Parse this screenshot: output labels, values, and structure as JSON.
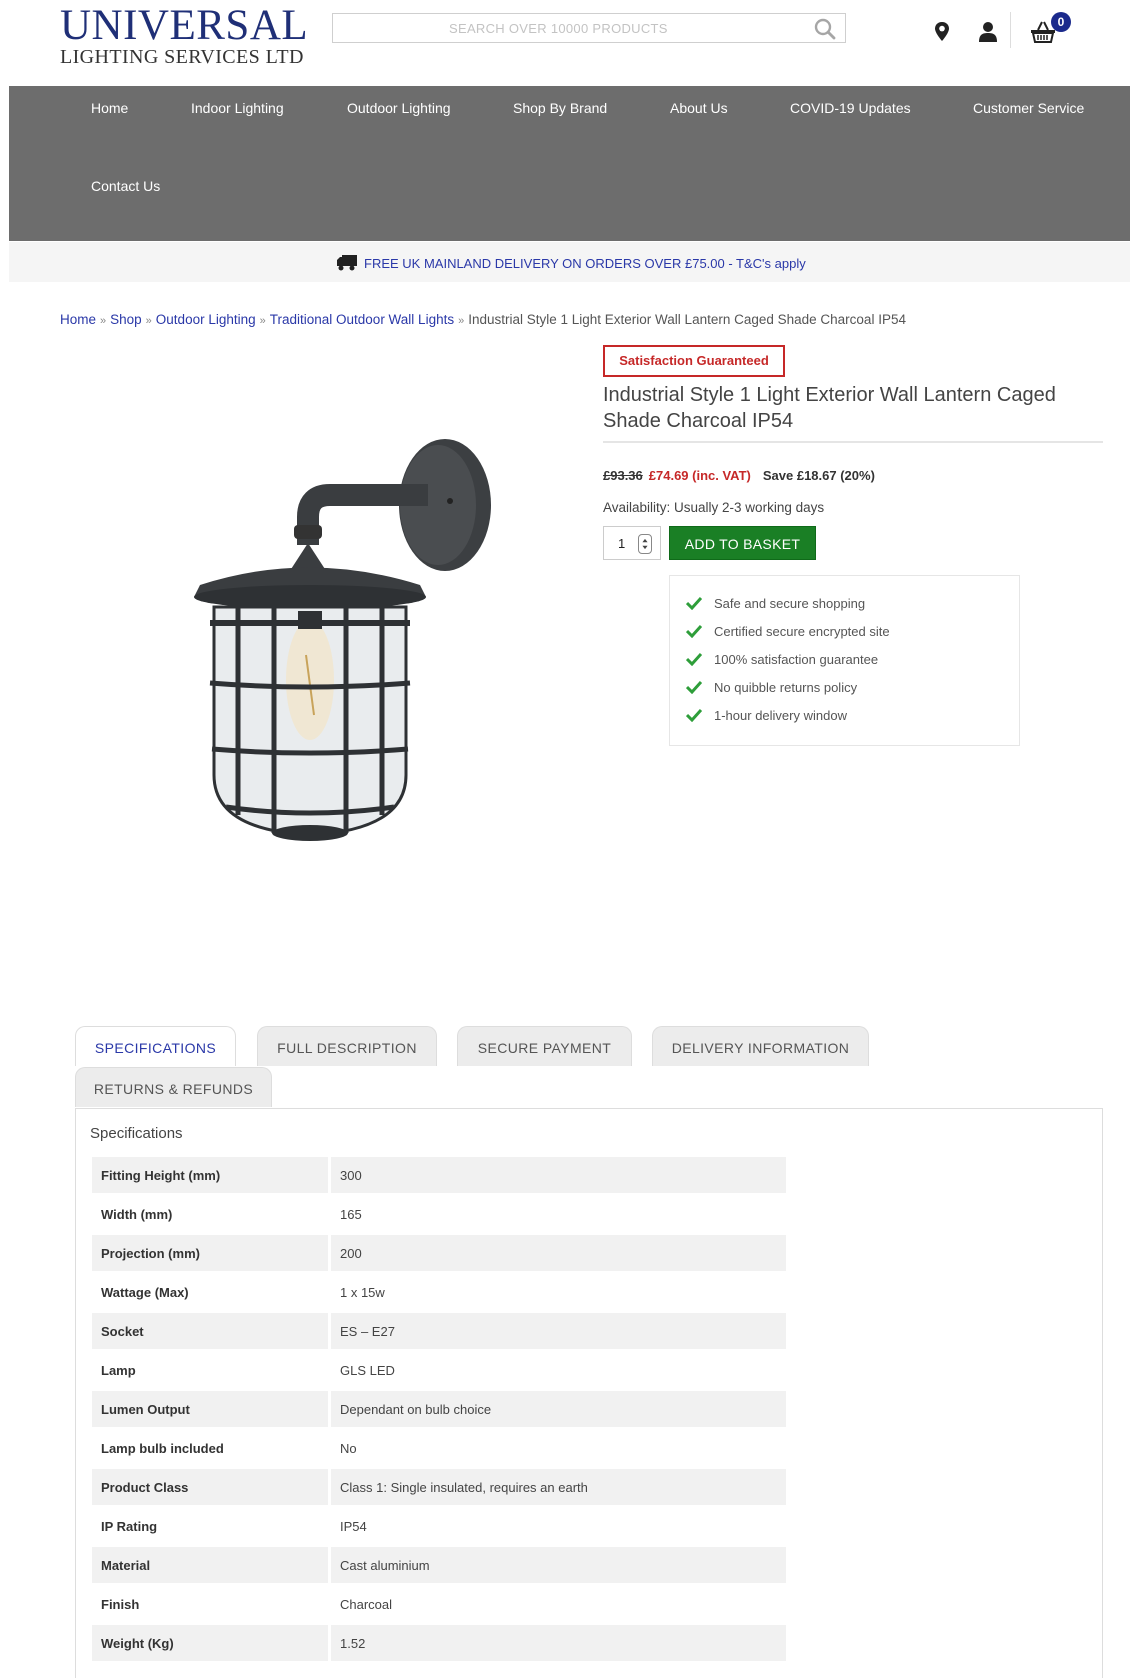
{
  "header": {
    "logo_main": "UNIVERSAL",
    "logo_sub": "LIGHTING SERVICES LTD",
    "search_placeholder": "SEARCH OVER 10000 PRODUCTS",
    "cart_count": "0"
  },
  "nav": {
    "items": [
      "Home",
      "Indoor Lighting",
      "Outdoor Lighting",
      "Shop By Brand",
      "About Us",
      "COVID-19 Updates",
      "Customer Service",
      "Contact Us"
    ]
  },
  "delivery": {
    "text": "FREE UK MAINLAND DELIVERY ON ORDERS OVER £75.00 - T&C's apply"
  },
  "breadcrumb": {
    "links": [
      "Home",
      "Shop",
      "Outdoor Lighting",
      "Traditional Outdoor Wall Lights"
    ],
    "current": "Industrial Style 1 Light Exterior Wall Lantern Caged Shade Charcoal IP54"
  },
  "product": {
    "badge": "Satisfaction Guaranteed",
    "title": "Industrial Style 1 Light Exterior Wall Lantern Caged Shade Charcoal IP54",
    "price_old": "£93.36",
    "price_new": "£74.69 (inc. VAT)",
    "price_save": "Save £18.67 (20%)",
    "availability": "Availability: Usually 2-3 working days",
    "quantity": "1",
    "add_to_basket": "ADD TO BASKET"
  },
  "assurances": [
    "Safe and secure shopping",
    "Certified secure encrypted site",
    "100% satisfaction guarantee",
    "No quibble returns policy",
    "1-hour delivery window"
  ],
  "tabs": [
    "SPECIFICATIONS",
    "FULL DESCRIPTION",
    "SECURE PAYMENT",
    "DELIVERY INFORMATION",
    "RETURNS & REFUNDS"
  ],
  "specifications": {
    "heading": "Specifications",
    "rows": [
      {
        "key": "Fitting Height (mm)",
        "value": "300"
      },
      {
        "key": "Width (mm)",
        "value": "165"
      },
      {
        "key": "Projection (mm)",
        "value": "200"
      },
      {
        "key": "Wattage (Max)",
        "value": "1 x 15w"
      },
      {
        "key": "Socket",
        "value": "ES – E27"
      },
      {
        "key": "Lamp",
        "value": "GLS LED"
      },
      {
        "key": "Lumen Output",
        "value": "Dependant on bulb choice"
      },
      {
        "key": "Lamp bulb included",
        "value": "No"
      },
      {
        "key": "Product Class",
        "value": "Class 1: Single insulated, requires an earth"
      },
      {
        "key": "IP Rating",
        "value": "IP54"
      },
      {
        "key": "Material",
        "value": "Cast aluminium"
      },
      {
        "key": "Finish",
        "value": "Charcoal"
      },
      {
        "key": "Weight (Kg)",
        "value": "1.52"
      }
    ]
  },
  "colors": {
    "brand_navy": "#1f2f77",
    "nav_grey": "#6d6d6d",
    "link_blue": "#2a38a8",
    "sale_red": "#c62828",
    "basket_green": "#1a7f25",
    "check_green": "#2e9e3a"
  }
}
